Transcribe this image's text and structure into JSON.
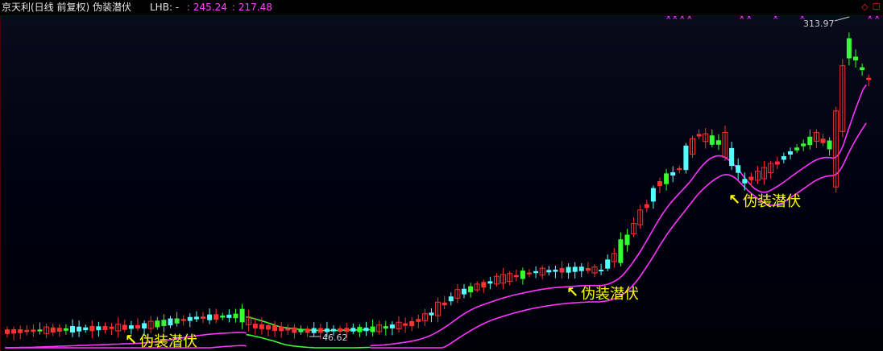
{
  "header": {
    "title": "京天利(日线 前复权) 伪装潜伏",
    "lhb_label": "LHB: -",
    "value1": ": 245.24",
    "value2": ": 217.48"
  },
  "window": {
    "restore_glyph": "◇",
    "close_glyph": "☐"
  },
  "colors": {
    "up": "#ff3030",
    "down_green": "#33ff33",
    "down_cyan": "#55ffff",
    "band": "#ff33ff",
    "band_green": "#33ff33",
    "annotation": "#ffff00",
    "marker": "#ff44ff"
  },
  "annotations": [
    {
      "text": "伪装潜伏",
      "arrow": "↖",
      "bar": 41
    },
    {
      "text": "伪装潜伏",
      "arrow": "↖",
      "bar": 179
    },
    {
      "text": "伪装潜伏",
      "arrow": "↖",
      "bar": 229
    }
  ],
  "price_labels": {
    "high": "313.97",
    "low": "46.62"
  },
  "markers": [
    "×",
    "×",
    "×",
    "×",
    "×",
    "×",
    "×",
    "×",
    "×",
    "×"
  ]
}
